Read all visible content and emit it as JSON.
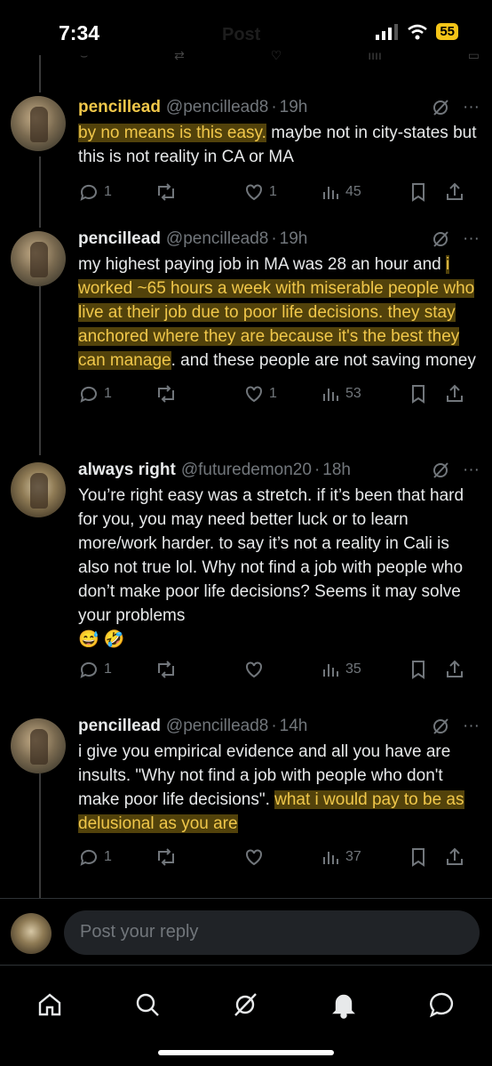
{
  "status_bar": {
    "time": "7:34",
    "battery": "55",
    "header_faint": "Post"
  },
  "tweets": [
    {
      "name": "pencillead",
      "handle": "@pencillead8",
      "time": "19h",
      "text_highlight": "by no means is this easy.",
      "text_rest": " maybe not in city-states but this is not reality in CA or MA",
      "replies": "1",
      "likes": "1",
      "views": "45"
    },
    {
      "name": "pencillead",
      "handle": "@pencillead8",
      "time": "19h",
      "text_a": "my highest paying job in MA was 28 an hour and ",
      "text_highlight": "i worked ~65 hours a week with miserable people who live at their job due to poor life decisions. they stay anchored where they are because it's the best they can manage",
      "text_rest": ". and these people are not saving money",
      "replies": "1",
      "likes": "1",
      "views": "53"
    },
    {
      "name": "always right",
      "handle": "@futuredemon20",
      "time": "18h",
      "text": "You’re right easy was a stretch. if it’s been that hard for you, you may need better luck or to learn more/work harder. to say it’s not a reality in Cali is also not true lol. Why not find a job with people who don’t make poor life decisions? Seems it may solve your problems",
      "emoji": "😅 🤣",
      "replies": "1",
      "likes": "",
      "views": "35"
    },
    {
      "name": "pencillead",
      "handle": "@pencillead8",
      "time": "14h",
      "text_a": "i give you empirical evidence and all you have are insults. \"Why not find a job with people who don't make poor life decisions\". ",
      "text_highlight": "what i would pay to be as delusional as you are",
      "replies": "1",
      "likes": "",
      "views": "37"
    }
  ],
  "reply": {
    "placeholder": "Post your reply"
  },
  "nav": [
    "home-icon",
    "search-icon",
    "grok-icon",
    "notifications-icon",
    "messages-icon"
  ],
  "colors": {
    "background": "#000000",
    "text": "#e7e9ea",
    "muted": "#71767b",
    "highlight": "#f0c74a",
    "battery": "#f5c518"
  }
}
